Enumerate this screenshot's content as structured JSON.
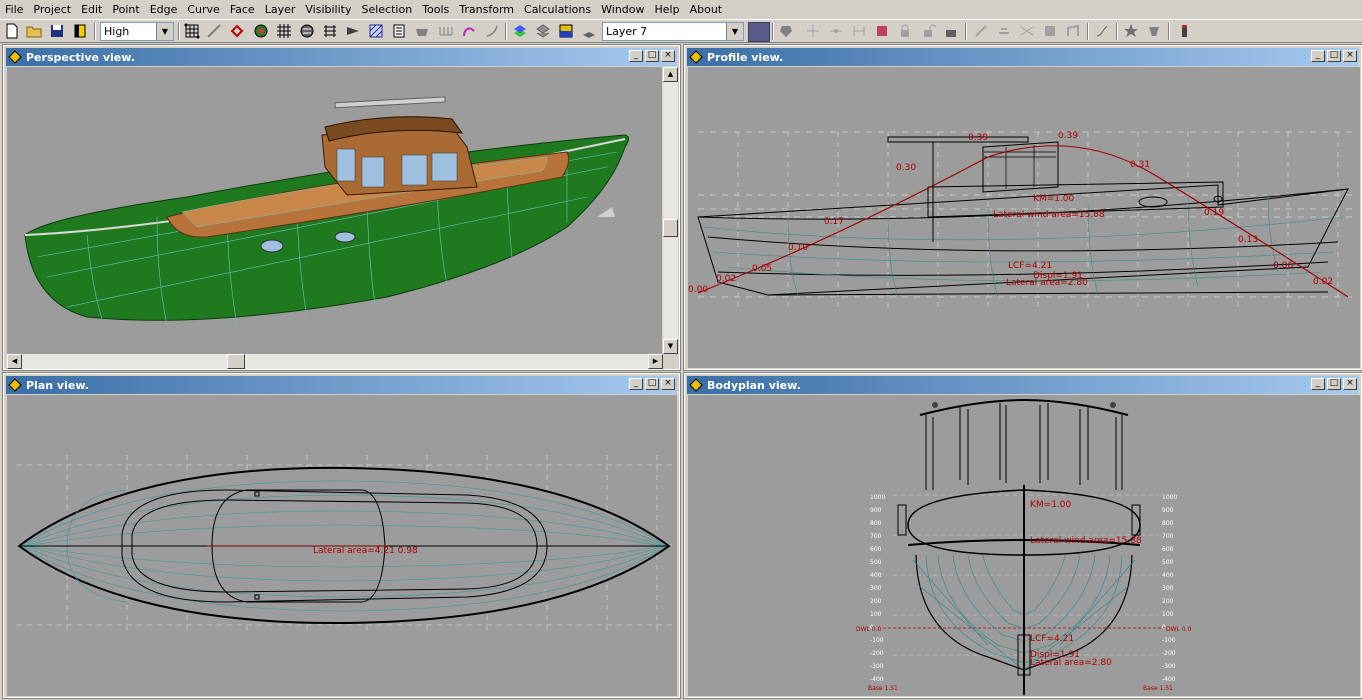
{
  "menu": [
    "File",
    "Project",
    "Edit",
    "Point",
    "Edge",
    "Curve",
    "Face",
    "Layer",
    "Visibility",
    "Selection",
    "Tools",
    "Transform",
    "Calculations",
    "Window",
    "Help",
    "About"
  ],
  "toolbar": {
    "precision_value": "High",
    "layer_value": "Layer 7"
  },
  "windows": {
    "perspective": {
      "title": "Perspective view."
    },
    "profile": {
      "title": "Profile view."
    },
    "plan": {
      "title": "Plan view."
    },
    "bodyplan": {
      "title": "Bodyplan view."
    }
  },
  "profile_labels": {
    "curve_values": [
      "0.00",
      "0.02",
      "0.05",
      "0.10",
      "0.17",
      "0.30",
      "0.39",
      "0.39",
      "0.31",
      "0.19",
      "0.13",
      "0.06",
      "0.02"
    ],
    "km": "KM=1.00",
    "lateral_wind": "Lateral wind area=15.88",
    "lcf": "LCF=4.21",
    "displ": "Displ=1.91",
    "lateral_area": "Lateral area=2.80"
  },
  "plan_labels": {
    "overlap": "Lateral area=4.21 0.98"
  },
  "bodyplan_labels": {
    "km": "KM=1.00",
    "lateral_wind": "Lateral wind area=15.88",
    "lcf": "LCF=4.21",
    "displ": "Displ=1.91",
    "lateral_area": "Lateral area=2.80",
    "ticks": [
      "1000",
      "900",
      "800",
      "700",
      "600",
      "500",
      "400",
      "300",
      "200",
      "100",
      "0",
      "-100",
      "-200",
      "-300",
      "-400"
    ],
    "dwl_left": "DWL 0.0",
    "dwl_right": "DWL 0.0",
    "base_left": "Base 1.51",
    "base_right": "Base 1.51"
  },
  "colors": {
    "hull_green": "#1f7a1f",
    "deck_wood": "#b8733a",
    "grid_line": "#5fb3b3",
    "label_red": "#b00000"
  }
}
